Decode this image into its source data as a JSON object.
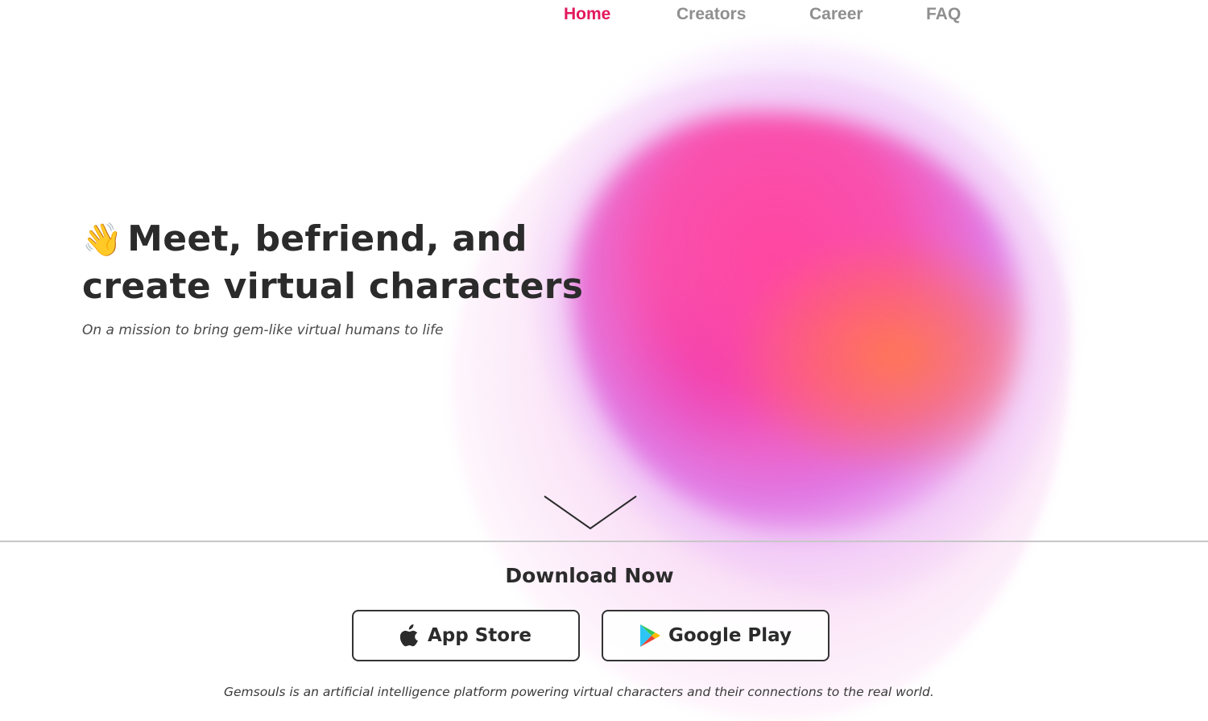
{
  "nav": {
    "items": [
      {
        "label": "Home",
        "active": true
      },
      {
        "label": "Creators",
        "active": false
      },
      {
        "label": "Career",
        "active": false
      },
      {
        "label": "FAQ",
        "active": false
      }
    ]
  },
  "hero": {
    "emoji": "👋",
    "title_line1": "Meet, befriend, and",
    "title_line2": "create virtual characters",
    "subtitle": "On a mission to bring gem-like virtual humans to life"
  },
  "download": {
    "title": "Download Now",
    "app_store_label": "App Store",
    "google_play_label": "Google Play"
  },
  "footer": {
    "description": "Gemsouls is an artificial intelligence platform powering virtual characters and their connections to the real world."
  },
  "colors": {
    "accent": "#e3185c",
    "nav_inactive": "#8f8f8f",
    "text": "#2b2b2b"
  },
  "icons": {
    "apple": "apple-logo-icon",
    "google_play": "google-play-icon",
    "chevron": "chevron-down-icon"
  }
}
